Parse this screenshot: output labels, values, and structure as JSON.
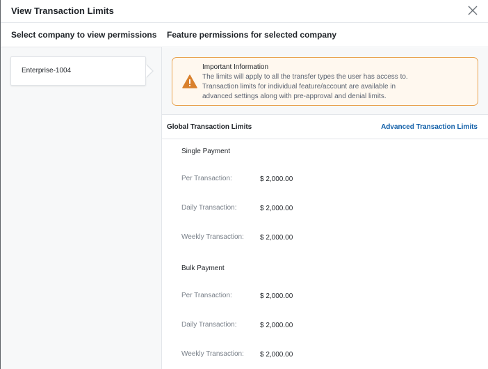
{
  "modal": {
    "title": "View Transaction Limits",
    "close_icon": "close-icon"
  },
  "left": {
    "heading": "Select company to view permissions",
    "companies": [
      {
        "name": "Enterprise-1004"
      }
    ]
  },
  "right": {
    "heading": "Feature permissions for selected company",
    "info": {
      "icon": "warning-icon",
      "title": "Important Information",
      "lines": [
        "The limits will apply to all the transfer types the user has access to.",
        "Transaction limits for individual feature/account are available in",
        "advanced settings along with pre-approval and denial limits."
      ]
    },
    "limits": {
      "title": "Global Transaction Limits",
      "advanced_link": "Advanced Transaction Limits",
      "sections": [
        {
          "title": "Single Payment",
          "rows": [
            {
              "label": "Per Transaction:",
              "value": "$ 2,000.00"
            },
            {
              "label": "Daily Transaction:",
              "value": "$ 2,000.00"
            },
            {
              "label": "Weekly Transaction:",
              "value": "$ 2,000.00"
            }
          ]
        },
        {
          "title": "Bulk Payment",
          "rows": [
            {
              "label": "Per Transaction:",
              "value": "$ 2,000.00"
            },
            {
              "label": "Daily Transaction:",
              "value": "$ 2,000.00"
            },
            {
              "label": "Weekly Transaction:",
              "value": "$ 2,000.00"
            }
          ]
        }
      ]
    }
  },
  "colors": {
    "accent_link": "#0f5ea8",
    "warning": "#e8a24f",
    "warning_icon": "#d9802c"
  }
}
